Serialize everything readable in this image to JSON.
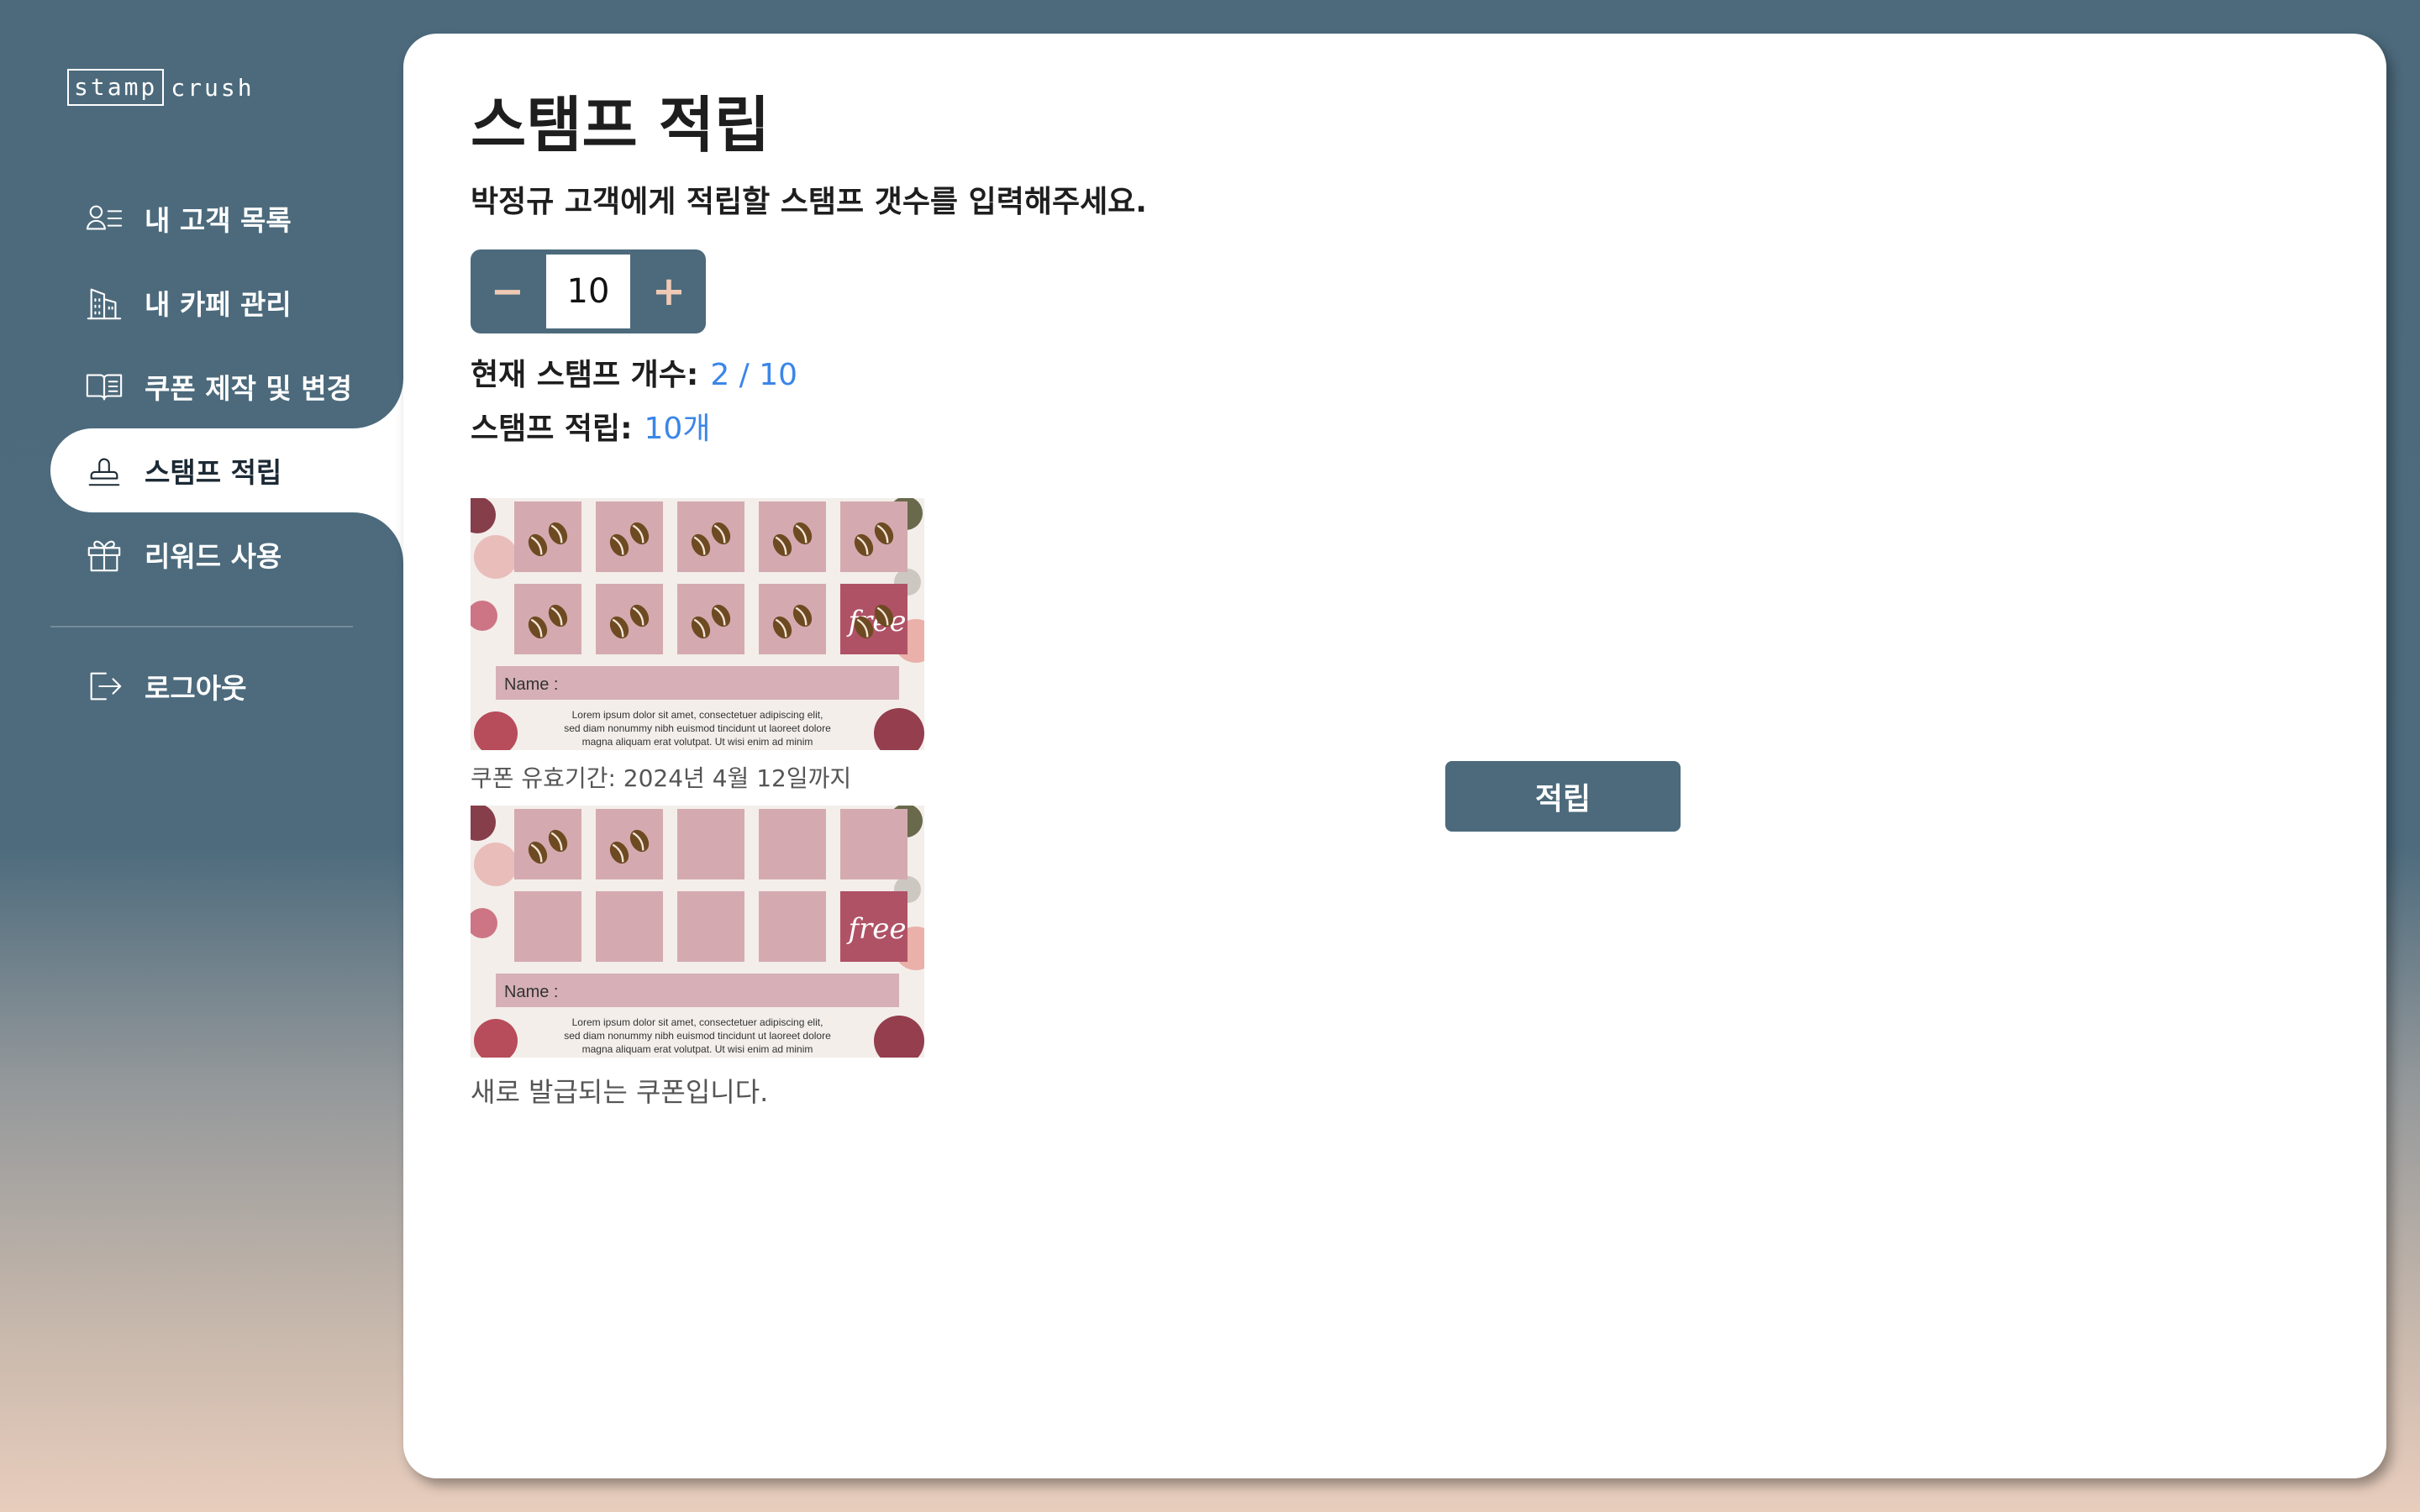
{
  "app": {
    "logo_box": "stamp",
    "logo_rest": "crush"
  },
  "sidebar": {
    "items": [
      {
        "label": "내 고객 목록",
        "icon": "customer-list-icon"
      },
      {
        "label": "내 카페 관리",
        "icon": "building-icon"
      },
      {
        "label": "쿠폰 제작 및 변경",
        "icon": "book-icon"
      },
      {
        "label": "스탬프 적립",
        "icon": "stamp-icon",
        "active": true
      },
      {
        "label": "리워드 사용",
        "icon": "gift-icon"
      }
    ],
    "logout_label": "로그아웃"
  },
  "main": {
    "title": "스탬프 적립",
    "subtitle": "박정규 고객에게 적립할 스탬프 갯수를 입력해주세요.",
    "stepper": {
      "minus": "−",
      "plus": "+",
      "value": "10"
    },
    "current_label": "현재 스탬프 개수:",
    "current_value": "2 / 10",
    "earn_label": "스탬프 적립:",
    "earn_value": "10개",
    "coupon1": {
      "filled_stamps": 10,
      "total": 10,
      "expiry_caption": "쿠폰 유효기간: 2024년 4월 12일까지"
    },
    "coupon2": {
      "filled_stamps": 2,
      "total": 10,
      "new_caption": "새로 발급되는 쿠폰입니다."
    },
    "coupon_text": {
      "name": "Name :",
      "free": "free",
      "lorem1": "Lorem ipsum dolor sit amet, consectetuer adipiscing elit,",
      "lorem2": "sed diam nonummy nibh euismod tincidunt ut laoreet dolore",
      "lorem3": "magna aliquam erat volutpat. Ut wisi enim ad minim"
    },
    "apply_button": "적립"
  },
  "colors": {
    "accent": "#4c6a7c",
    "highlight": "#3a86e8",
    "stepper_sign": "#f0c9b5",
    "coupon_cell": "#d4aab0",
    "coupon_free": "#b05266"
  }
}
